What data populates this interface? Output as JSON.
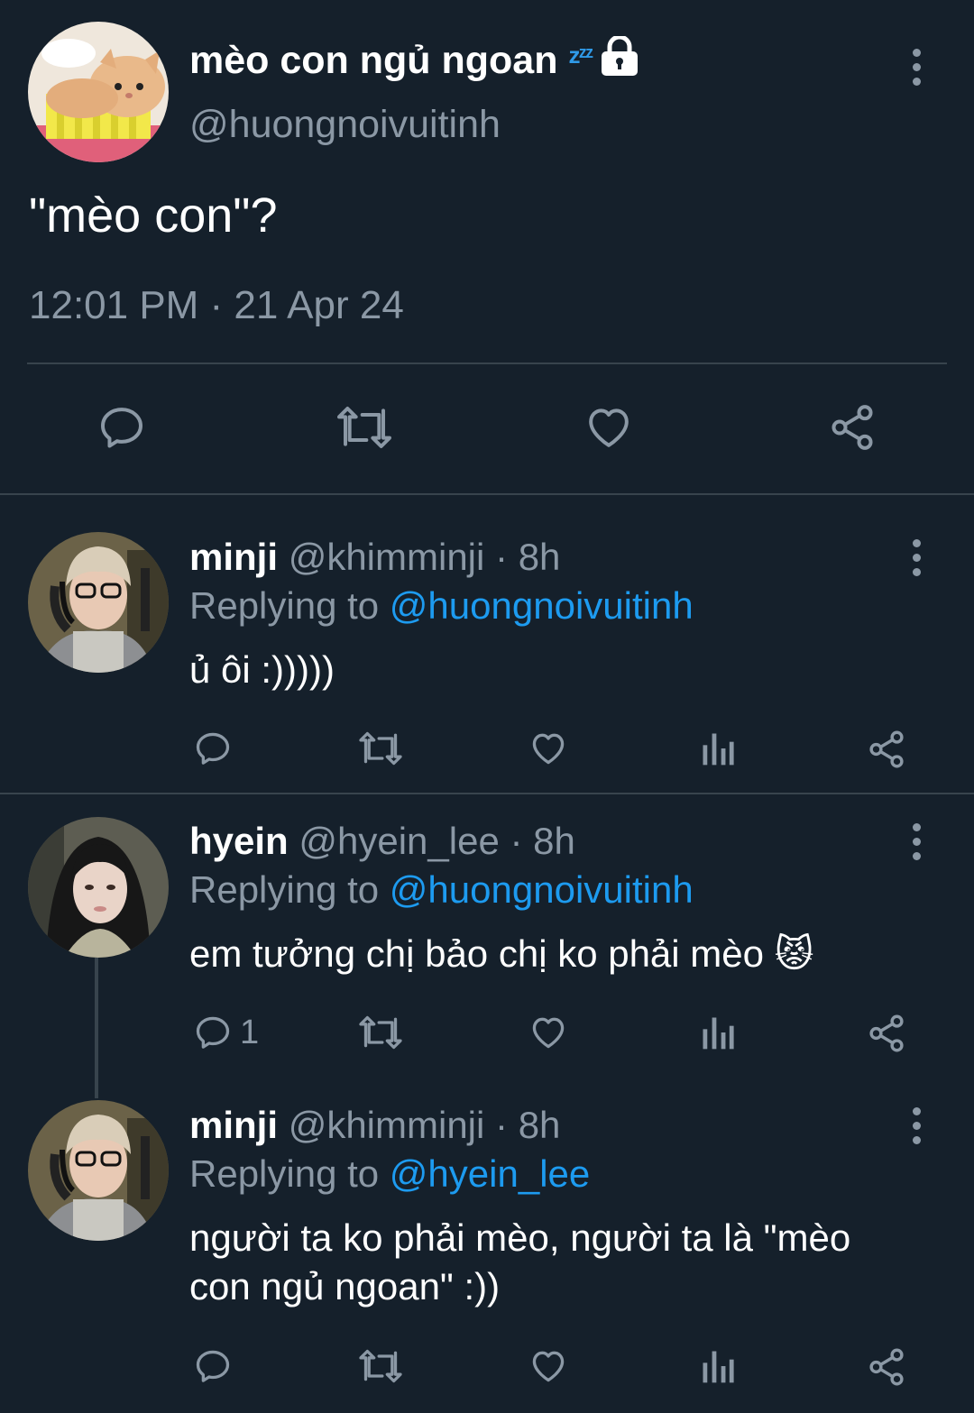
{
  "main": {
    "name": "mèo con ngủ ngoan",
    "sleep_emoji": "zᶻᶻ",
    "handle": "@huongnoivuitinh",
    "text": "\"mèo con\"?",
    "timestamp": "12:01 PM · 21 Apr 24",
    "actions": [
      "reply-icon",
      "retweet-icon",
      "like-icon",
      "share-icon"
    ]
  },
  "replies": [
    {
      "name": "minji",
      "handle": "@khimminji",
      "time": "8h",
      "replying_label": "Replying to",
      "replying_to": "@huongnoivuitinh",
      "text": "ủ ôi :)))))",
      "reply_count": ""
    },
    {
      "name": "hyein",
      "handle": "@hyein_lee",
      "time": "8h",
      "replying_label": "Replying to",
      "replying_to": "@huongnoivuitinh",
      "text": "em tưởng chị bảo chị ko phải mèo",
      "emoji": "😾",
      "reply_count": "1"
    },
    {
      "name": "minji",
      "handle": "@khimminji",
      "time": "8h",
      "replying_label": "Replying to",
      "replying_to": "@hyein_lee",
      "text": "người ta ko phải mèo, người ta là \"mèo con ngủ ngoan\" :))",
      "reply_count": ""
    }
  ],
  "colors": {
    "background": "#15202b",
    "muted": "#8b98a5",
    "link": "#1d9bf0",
    "divider": "#38444d"
  }
}
